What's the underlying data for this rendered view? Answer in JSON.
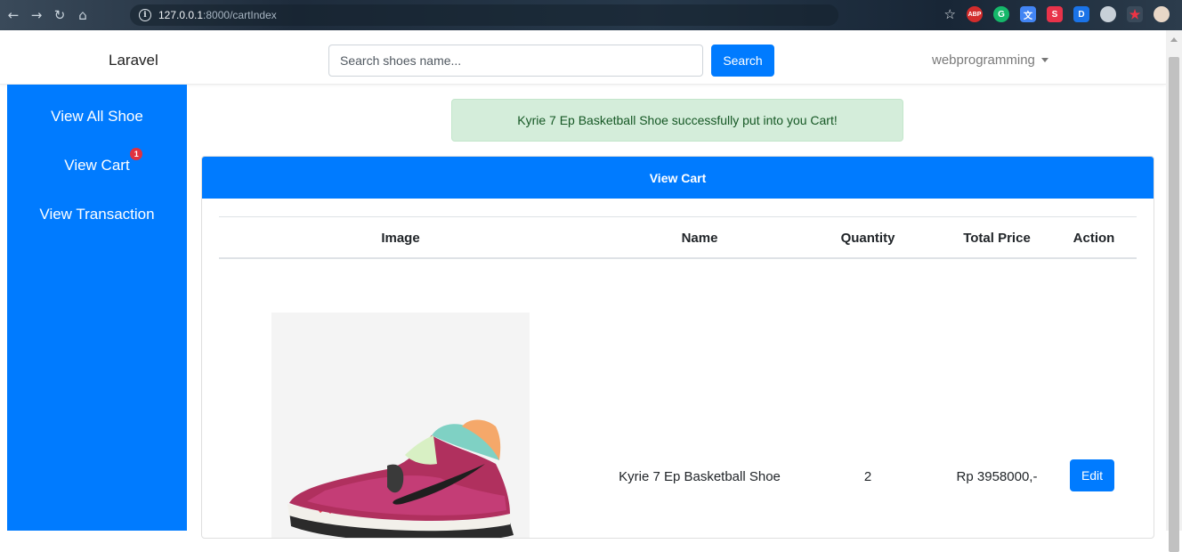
{
  "browser": {
    "url_host": "127.0.0.1",
    "url_path": ":8000/cartIndex",
    "extensions": [
      {
        "name": "abp-icon",
        "label": "ABP",
        "color": "#d22c2c"
      },
      {
        "name": "grammarly-icon",
        "label": "G",
        "color": "#15b86a"
      },
      {
        "name": "translate-icon",
        "label": "文",
        "color": "#4285f4"
      },
      {
        "name": "s-extension-icon",
        "label": "S",
        "color": "#e8334a"
      },
      {
        "name": "d-extension-icon",
        "label": "D",
        "color": "#1a73e8"
      }
    ]
  },
  "navbar": {
    "brand": "Laravel",
    "search_placeholder": "Search shoes name...",
    "search_button": "Search",
    "user": "webprogramming"
  },
  "sidebar": {
    "items": [
      {
        "label": "View All Shoe"
      },
      {
        "label": "View Cart",
        "badge": "1"
      },
      {
        "label": "View Transaction"
      }
    ]
  },
  "alert": {
    "message": "Kyrie 7 Ep Basketball Shoe successfully put into you Cart!"
  },
  "cart": {
    "title": "View Cart",
    "columns": [
      "Image",
      "Name",
      "Quantity",
      "Total Price",
      "Action"
    ],
    "rows": [
      {
        "image": "basketball-shoe-image",
        "name": "Kyrie 7 Ep Basketball Shoe",
        "quantity": "2",
        "total_price": "Rp 3958000,-",
        "action": "Edit"
      }
    ]
  },
  "colors": {
    "primary": "#007bff",
    "alert_bg": "#d4edda",
    "alert_text": "#155724",
    "badge": "#e0323f"
  }
}
